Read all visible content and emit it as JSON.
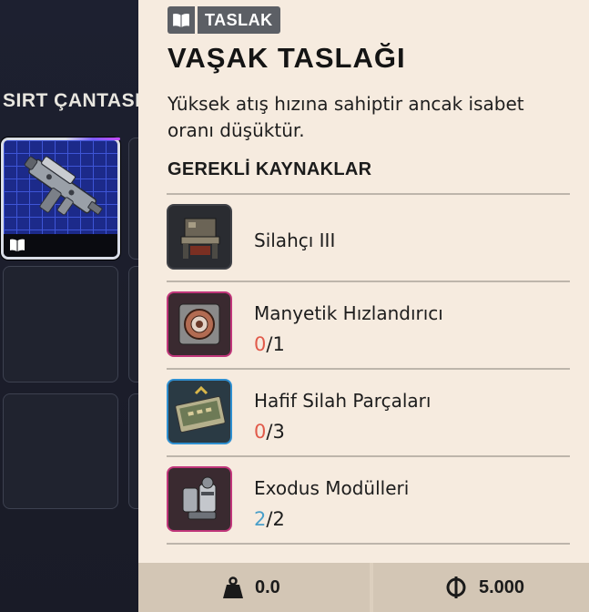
{
  "inventory": {
    "section_title": "SIRT ÇANTASI"
  },
  "blueprint": {
    "badge_label": "TASLAK",
    "title": "VAŞAK TASLAĞI",
    "description": "Yüksek atış hızına sahiptir ancak isabet oranı düşüktür.",
    "requirements_title": "GEREKLİ KAYNAKLAR",
    "resources": [
      {
        "name": "Silahçı III",
        "have": "",
        "slash": "",
        "need": "",
        "rarity_color": "#3f4147"
      },
      {
        "name": "Manyetik Hızlandırıcı",
        "have": "0",
        "slash": "/",
        "need": "1",
        "rarity_color": "#c0367a"
      },
      {
        "name": "Hafif Silah Parçaları",
        "have": "0",
        "slash": "/",
        "need": "3",
        "rarity_color": "#2f8fd0"
      },
      {
        "name": "Exodus Modülleri",
        "have": "2",
        "slash": "/",
        "need": "2",
        "rarity_color": "#c0367a"
      }
    ]
  },
  "footer": {
    "weight": "0.0",
    "price": "5.000"
  },
  "icons": {
    "badge": "book-icon",
    "weight": "weight-icon",
    "currency": "coin-icon"
  }
}
